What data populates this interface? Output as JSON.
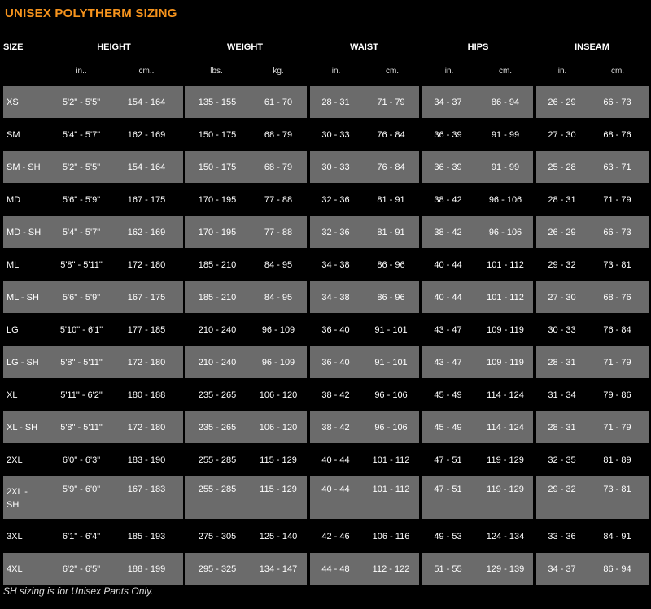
{
  "title": "UNISEX POLYTHERM SIZING",
  "headers": {
    "size": "SIZE",
    "height": "HEIGHT",
    "weight": "WEIGHT",
    "waist": "WAIST",
    "hips": "HIPS",
    "inseam": "INSEAM"
  },
  "units": {
    "height_in": "in..",
    "height_cm": "cm..",
    "weight_lbs": "lbs.",
    "weight_kg": "kg.",
    "waist_in": "in.",
    "waist_cm": "cm.",
    "hips_in": "in.",
    "hips_cm": "cm.",
    "inseam_in": "in.",
    "inseam_cm": "cm."
  },
  "rows": [
    {
      "size": "XS",
      "h_in": "5'2\" - 5'5\"",
      "h_cm": "154 - 164",
      "w_lbs": "135 - 155",
      "w_kg": "61 - 70",
      "wa_in": "28 - 31",
      "wa_cm": "71 - 79",
      "hi_in": "34 - 37",
      "hi_cm": "86 - 94",
      "in_in": "26 - 29",
      "in_cm": "66 - 73"
    },
    {
      "size": "SM",
      "h_in": "5'4\" - 5'7\"",
      "h_cm": "162 - 169",
      "w_lbs": "150 - 175",
      "w_kg": "68 - 79",
      "wa_in": "30 - 33",
      "wa_cm": "76 - 84",
      "hi_in": "36 - 39",
      "hi_cm": "91 - 99",
      "in_in": "27 - 30",
      "in_cm": "68 - 76"
    },
    {
      "size": "SM - SH",
      "h_in": "5'2\" - 5'5\"",
      "h_cm": "154 - 164",
      "w_lbs": "150 - 175",
      "w_kg": "68 - 79",
      "wa_in": "30 - 33",
      "wa_cm": "76 - 84",
      "hi_in": "36 - 39",
      "hi_cm": "91 - 99",
      "in_in": "25 - 28",
      "in_cm": "63 - 71"
    },
    {
      "size": "MD",
      "h_in": "5'6\" - 5'9\"",
      "h_cm": "167 - 175",
      "w_lbs": "170 - 195",
      "w_kg": "77 - 88",
      "wa_in": "32 - 36",
      "wa_cm": "81 - 91",
      "hi_in": "38 - 42",
      "hi_cm": "96 - 106",
      "in_in": "28 - 31",
      "in_cm": "71 - 79"
    },
    {
      "size": "MD - SH",
      "h_in": "5'4\" - 5'7\"",
      "h_cm": "162 - 169",
      "w_lbs": "170 - 195",
      "w_kg": "77 - 88",
      "wa_in": "32 - 36",
      "wa_cm": "81 - 91",
      "hi_in": "38 - 42",
      "hi_cm": "96 - 106",
      "in_in": "26 - 29",
      "in_cm": "66 - 73"
    },
    {
      "size": "ML",
      "h_in": "5'8\" - 5'11\"",
      "h_cm": "172 - 180",
      "w_lbs": "185 - 210",
      "w_kg": "84 - 95",
      "wa_in": "34 - 38",
      "wa_cm": "86 - 96",
      "hi_in": "40 - 44",
      "hi_cm": "101 - 112",
      "in_in": "29 - 32",
      "in_cm": "73 - 81"
    },
    {
      "size": "ML - SH",
      "h_in": "5'6\" - 5'9\"",
      "h_cm": "167 - 175",
      "w_lbs": "185 - 210",
      "w_kg": "84 - 95",
      "wa_in": "34 - 38",
      "wa_cm": "86 - 96",
      "hi_in": "40 - 44",
      "hi_cm": "101 - 112",
      "in_in": "27 - 30",
      "in_cm": "68 - 76"
    },
    {
      "size": "LG",
      "h_in": "5'10\" - 6'1\"",
      "h_cm": "177 - 185",
      "w_lbs": "210 - 240",
      "w_kg": "96 - 109",
      "wa_in": "36 - 40",
      "wa_cm": "91 - 101",
      "hi_in": "43 - 47",
      "hi_cm": "109 - 119",
      "in_in": "30 - 33",
      "in_cm": "76 - 84"
    },
    {
      "size": "LG - SH",
      "h_in": "5'8\" - 5'11\"",
      "h_cm": "172 - 180",
      "w_lbs": "210 - 240",
      "w_kg": "96 - 109",
      "wa_in": "36 - 40",
      "wa_cm": "91 - 101",
      "hi_in": "43 - 47",
      "hi_cm": "109 - 119",
      "in_in": "28 - 31",
      "in_cm": "71 - 79"
    },
    {
      "size": "XL",
      "h_in": "5'11\" - 6'2\"",
      "h_cm": "180 - 188",
      "w_lbs": "235 - 265",
      "w_kg": "106 - 120",
      "wa_in": "38 - 42",
      "wa_cm": "96 - 106",
      "hi_in": "45 - 49",
      "hi_cm": "114 - 124",
      "in_in": "31 - 34",
      "in_cm": "79 - 86"
    },
    {
      "size": "XL - SH",
      "h_in": "5'8\" - 5'11\"",
      "h_cm": "172 - 180",
      "w_lbs": "235 - 265",
      "w_kg": "106 - 120",
      "wa_in": "38 - 42",
      "wa_cm": "96 - 106",
      "hi_in": "45 - 49",
      "hi_cm": "114 - 124",
      "in_in": "28 - 31",
      "in_cm": "71 - 79"
    },
    {
      "size": "2XL",
      "h_in": "6'0\" - 6'3\"",
      "h_cm": "183 - 190",
      "w_lbs": "255 - 285",
      "w_kg": "115 - 129",
      "wa_in": "40 - 44",
      "wa_cm": "101 - 112",
      "hi_in": "47 - 51",
      "hi_cm": "119 - 129",
      "in_in": "32 - 35",
      "in_cm": "81 - 89"
    },
    {
      "size": "2XL - SH",
      "h_in": "5'9\" - 6'0\"",
      "h_cm": "167 - 183",
      "w_lbs": "255 - 285",
      "w_kg": "115 - 129",
      "wa_in": "40 - 44",
      "wa_cm": "101 - 112",
      "hi_in": "47 - 51",
      "hi_cm": "119 - 129",
      "in_in": "29 - 32",
      "in_cm": "73 - 81"
    },
    {
      "size": "3XL",
      "h_in": "6'1\" - 6'4\"",
      "h_cm": "185 - 193",
      "w_lbs": "275 - 305",
      "w_kg": "125 - 140",
      "wa_in": "42 - 46",
      "wa_cm": "106 - 116",
      "hi_in": "49 - 53",
      "hi_cm": "124 - 134",
      "in_in": "33 - 36",
      "in_cm": "84 - 91"
    },
    {
      "size": "4XL",
      "h_in": "6'2\" - 6'5\"",
      "h_cm": "188 - 199",
      "w_lbs": "295 - 325",
      "w_kg": "134 - 147",
      "wa_in": "44 - 48",
      "wa_cm": "112 - 122",
      "hi_in": "51 - 55",
      "hi_cm": "129 - 139",
      "in_in": "34 - 37",
      "in_cm": "86 - 94"
    }
  ],
  "footnote": "SH sizing is for Unisex Pants Only.",
  "colors": {
    "title": "#f7941d",
    "shaded_row": "#6b6b6b",
    "background": "#000000"
  }
}
